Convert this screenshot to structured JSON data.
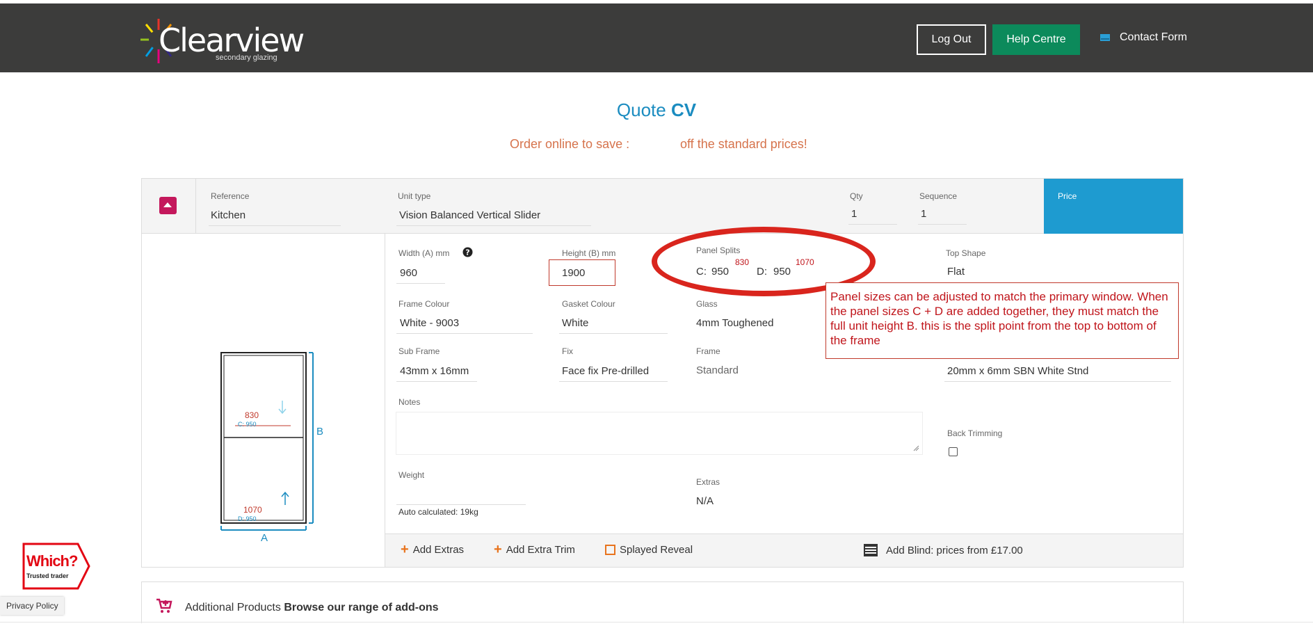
{
  "header": {
    "logo_text": "Clearview",
    "logo_sub": "secondary glazing",
    "logout_label": "Log Out",
    "help_label": "Help Centre",
    "contact_label": "Contact Form"
  },
  "quote": {
    "title_prefix": "Quote",
    "title_suffix": "CV",
    "promo_before": "Order online to save :",
    "promo_after": "off the standard prices!"
  },
  "unit_header": {
    "reference_label": "Reference",
    "reference_value": "Kitchen",
    "unit_type_label": "Unit type",
    "unit_type_value": "Vision Balanced Vertical Slider",
    "qty_label": "Qty",
    "qty_value": "1",
    "sequence_label": "Sequence",
    "sequence_value": "1",
    "price_label": "Price"
  },
  "form": {
    "width_label": "Width (A) mm",
    "width_value": "960",
    "height_label": "Height (B) mm",
    "height_value": "1900",
    "panel_splits_label": "Panel Splits",
    "c_label": "C:",
    "c_value": "950",
    "c_annotation": "830",
    "d_label": "D:",
    "d_value": "950",
    "d_annotation": "1070",
    "top_shape_label": "Top Shape",
    "top_shape_value": "Flat",
    "frame_colour_label": "Frame Colour",
    "frame_colour_value": "White - 9003",
    "gasket_colour_label": "Gasket Colour",
    "gasket_colour_value": "White",
    "glass_label": "Glass",
    "glass_value": "4mm Toughened",
    "sub_frame_label": "Sub Frame",
    "sub_frame_value": "43mm x 16mm",
    "fix_label": "Fix",
    "fix_value": "Face fix Pre-drilled",
    "frame_label": "Frame",
    "frame_value": "Standard",
    "trim_value": "20mm x 6mm SBN White Stnd",
    "notes_label": "Notes",
    "back_trimming_label": "Back Trimming",
    "weight_label": "Weight",
    "weight_note": "Auto calculated: 19kg",
    "extras_label": "Extras",
    "extras_value": "N/A"
  },
  "diagram": {
    "top_value": "830",
    "top_sub": "C: 950",
    "bottom_value": "1070",
    "bottom_sub": "D: 950",
    "side_label": "B",
    "base_label": "A"
  },
  "callout_text": "Panel sizes can be adjusted  to match the primary window. When the panel sizes C + D are added together, they must match the full unit height B. this is the split point from the top to bottom of the frame",
  "actions": {
    "add_extras": "Add Extras",
    "add_extra_trim": "Add Extra Trim",
    "splayed_reveal": "Splayed Reveal",
    "add_blind": "Add Blind: prices from £17.00"
  },
  "additional": {
    "prefix": "Additional Products",
    "link": "Browse our range of add-ons"
  },
  "badge": {
    "which": "Which?",
    "trusted": "Trusted trader"
  },
  "privacy_label": "Privacy Policy",
  "colors": {
    "header_bg": "#3c3c3b",
    "help_green": "#0c8a5b",
    "price_blue": "#1e9bd0",
    "accent_red": "#d9251d",
    "promo_orange": "#d6734c"
  }
}
